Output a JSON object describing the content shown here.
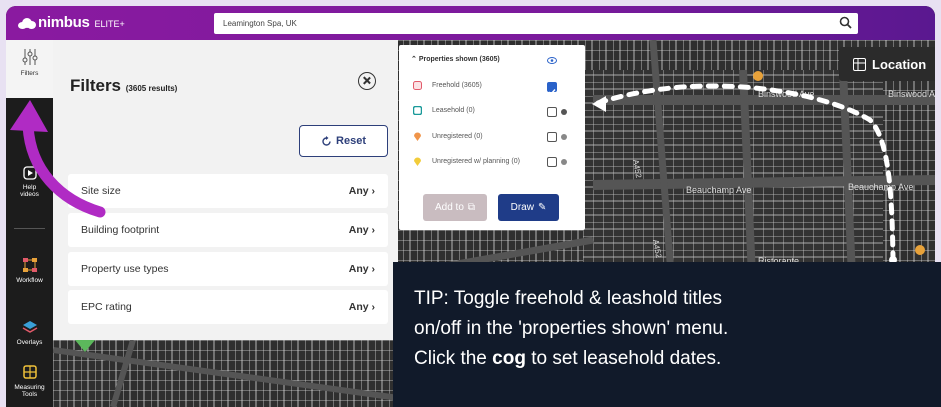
{
  "brand": {
    "name": "nimbus",
    "tier": "ELITE+"
  },
  "search": {
    "value": "Leamington Spa, UK"
  },
  "sidebar": {
    "items": [
      {
        "label": "Filters",
        "icon": "sliders-icon"
      },
      {
        "label": "Help videos",
        "icon": "play-icon"
      },
      {
        "label": "Workflow",
        "icon": "workflow-icon"
      },
      {
        "label": "Overlays",
        "icon": "layers-icon"
      },
      {
        "label": "Measuring Tools",
        "icon": "ruler-icon"
      }
    ]
  },
  "filters": {
    "title": "Filters",
    "count": "(3605 results)",
    "reset_label": "Reset",
    "rows": [
      {
        "label": "Site size",
        "value": "Any"
      },
      {
        "label": "Building footprint",
        "value": "Any"
      },
      {
        "label": "Property use types",
        "value": "Any"
      },
      {
        "label": "EPC rating",
        "value": "Any"
      }
    ]
  },
  "properties": {
    "header": "Properties shown (3605)",
    "rows": [
      {
        "label": "Freehold (3605)",
        "checked": true,
        "color": "#e25a6a"
      },
      {
        "label": "Leasehold (0)",
        "checked": false,
        "color": "#1a9a9a",
        "cog": true
      },
      {
        "label": "Unregistered (0)",
        "checked": false,
        "color": "#f0954a",
        "info": true
      },
      {
        "label": "Unregistered w/ planning (0)",
        "checked": false,
        "color": "#f2cc3a",
        "info": true
      }
    ],
    "add_label": "Add to",
    "draw_label": "Draw"
  },
  "map": {
    "location_label": "Location",
    "streets": [
      "Binswood Ave",
      "Binswood Ave",
      "Beauchamp Ave",
      "Beauchamp Ave",
      "A452",
      "A452",
      "Ristorante"
    ]
  },
  "tip": {
    "line1": "TIP: Toggle freehold & leashold titles",
    "line2": "on/off in the 'properties shown' menu.",
    "line3_pre": "Click the ",
    "line3_bold": "cog",
    "line3_post": " to set leasehold dates."
  },
  "colors": {
    "topbar": "#8a1aa0",
    "accent_arrow": "#b02bc4",
    "draw_button": "#1f3c88",
    "tip_bg": "#111a2a"
  }
}
